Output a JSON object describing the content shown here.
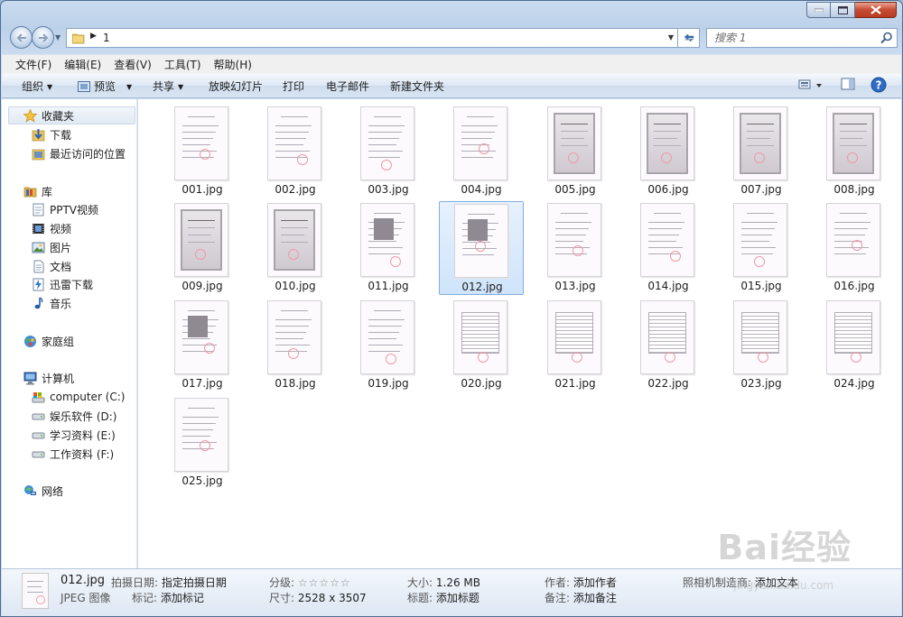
{
  "window": {
    "address_crumb": "1",
    "search_placeholder": "搜索 1"
  },
  "menu": [
    "文件(F)",
    "编辑(E)",
    "查看(V)",
    "工具(T)",
    "帮助(H)"
  ],
  "commands": {
    "organize": "组织",
    "preview": "预览",
    "share": "共享",
    "slideshow": "放映幻灯片",
    "print": "打印",
    "email": "电子邮件",
    "new_folder": "新建文件夹"
  },
  "nav": {
    "favorites": "收藏夹",
    "downloads": "下载",
    "recent": "最近访问的位置",
    "libraries": "库",
    "pptv": "PPTV视频",
    "videos": "视频",
    "pictures": "图片",
    "documents": "文档",
    "thunder": "迅雷下载",
    "music": "音乐",
    "homegroup": "家庭组",
    "computer": "计算机",
    "drive_c": "computer (C:)",
    "drive_d": "娱乐软件 (D:)",
    "drive_e": "学习资料 (E:)",
    "drive_f": "工作资料 (F:)",
    "network": "网络"
  },
  "files": [
    "001.jpg",
    "002.jpg",
    "003.jpg",
    "004.jpg",
    "005.jpg",
    "006.jpg",
    "007.jpg",
    "008.jpg",
    "009.jpg",
    "010.jpg",
    "011.jpg",
    "012.jpg",
    "013.jpg",
    "014.jpg",
    "015.jpg",
    "016.jpg",
    "017.jpg",
    "018.jpg",
    "019.jpg",
    "020.jpg",
    "021.jpg",
    "022.jpg",
    "023.jpg",
    "024.jpg",
    "025.jpg"
  ],
  "selected_file": "012.jpg",
  "details": {
    "name": "012.jpg",
    "type": "JPEG 图像",
    "date_label": "拍摄日期:",
    "date_value": "指定拍摄日期",
    "tags_label": "标记:",
    "tags_value": "添加标记",
    "rating_label": "分级:",
    "rating_value": "☆☆☆☆☆",
    "dimensions_label": "尺寸:",
    "dimensions_value": "2528 x 3507",
    "size_label": "大小:",
    "size_value": "1.26 MB",
    "title_label": "标题:",
    "title_value": "添加标题",
    "author_label": "作者:",
    "author_value": "添加作者",
    "comments_label": "备注:",
    "comments_value": "添加备注",
    "maker_label": "照相机制造商:",
    "maker_value": "添加文本"
  },
  "watermark": {
    "brand": "Bai经验",
    "url": "jingyan.baidu.com"
  }
}
